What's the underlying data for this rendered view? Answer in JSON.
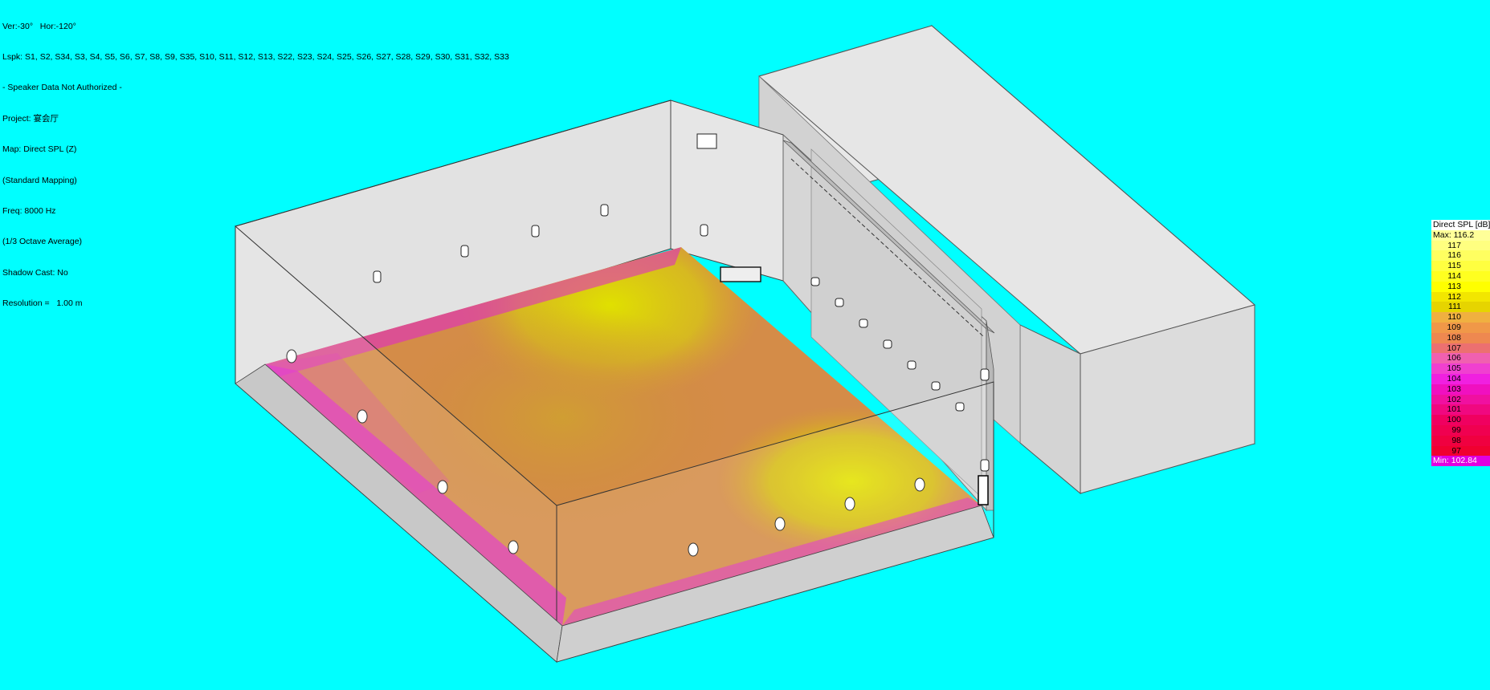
{
  "info": {
    "view": "Ver:-30°   Hor:-120°",
    "loudspeakers": "Lspk: S1, S2, S34, S3, S4, S5, S6, S7, S8, S9, S35, S10, S11, S12, S13, S22, S23, S24, S25, S26, S27, S28, S29, S30, S31, S32, S33",
    "notice": "- Speaker Data Not Authorized -",
    "project": "Project: 宴会厅",
    "map": "Map: Direct SPL (Z)",
    "mapping": "(Standard Mapping)",
    "freq": "Freq: 8000 Hz",
    "average": "(1/3 Octave Average)",
    "shadow": "Shadow Cast: No",
    "resolution": "Resolution =   1.00 m"
  },
  "legend": {
    "title": "Direct SPL [dB]",
    "max_label": "Max:  116.2",
    "min_label": "Min:  102.84",
    "steps": [
      {
        "label": "117",
        "color": "#FFFF80"
      },
      {
        "label": "116",
        "color": "#FFFF60"
      },
      {
        "label": "115",
        "color": "#FFFF40"
      },
      {
        "label": "114",
        "color": "#FFFF20"
      },
      {
        "label": "113",
        "color": "#FFFF00"
      },
      {
        "label": "112",
        "color": "#F2E600"
      },
      {
        "label": "111",
        "color": "#E6D400"
      },
      {
        "label": "110",
        "color": "#F0B040"
      },
      {
        "label": "109",
        "color": "#F09848"
      },
      {
        "label": "108",
        "color": "#EE8850"
      },
      {
        "label": "107",
        "color": "#EC7070"
      },
      {
        "label": "106",
        "color": "#F060B0"
      },
      {
        "label": "105",
        "color": "#F040D0"
      },
      {
        "label": "104",
        "color": "#F020E0"
      },
      {
        "label": "103",
        "color": "#F010C0"
      },
      {
        "label": "102",
        "color": "#F010A0"
      },
      {
        "label": "101",
        "color": "#F00880"
      },
      {
        "label": "100",
        "color": "#F00060"
      },
      {
        "label": "99",
        "color": "#F00050"
      },
      {
        "label": "98",
        "color": "#F00040"
      },
      {
        "label": "97",
        "color": "#F00030"
      }
    ],
    "header_color": "#FFFF99",
    "min_color": "#E000E0"
  },
  "colors": {
    "background": "#00FFFF",
    "wall": "#E4E4E4",
    "wall_shade": "#D0D0D0",
    "floor_hot": "#D8D800",
    "floor_mid": "#D89040",
    "floor_low": "#E010D0"
  }
}
